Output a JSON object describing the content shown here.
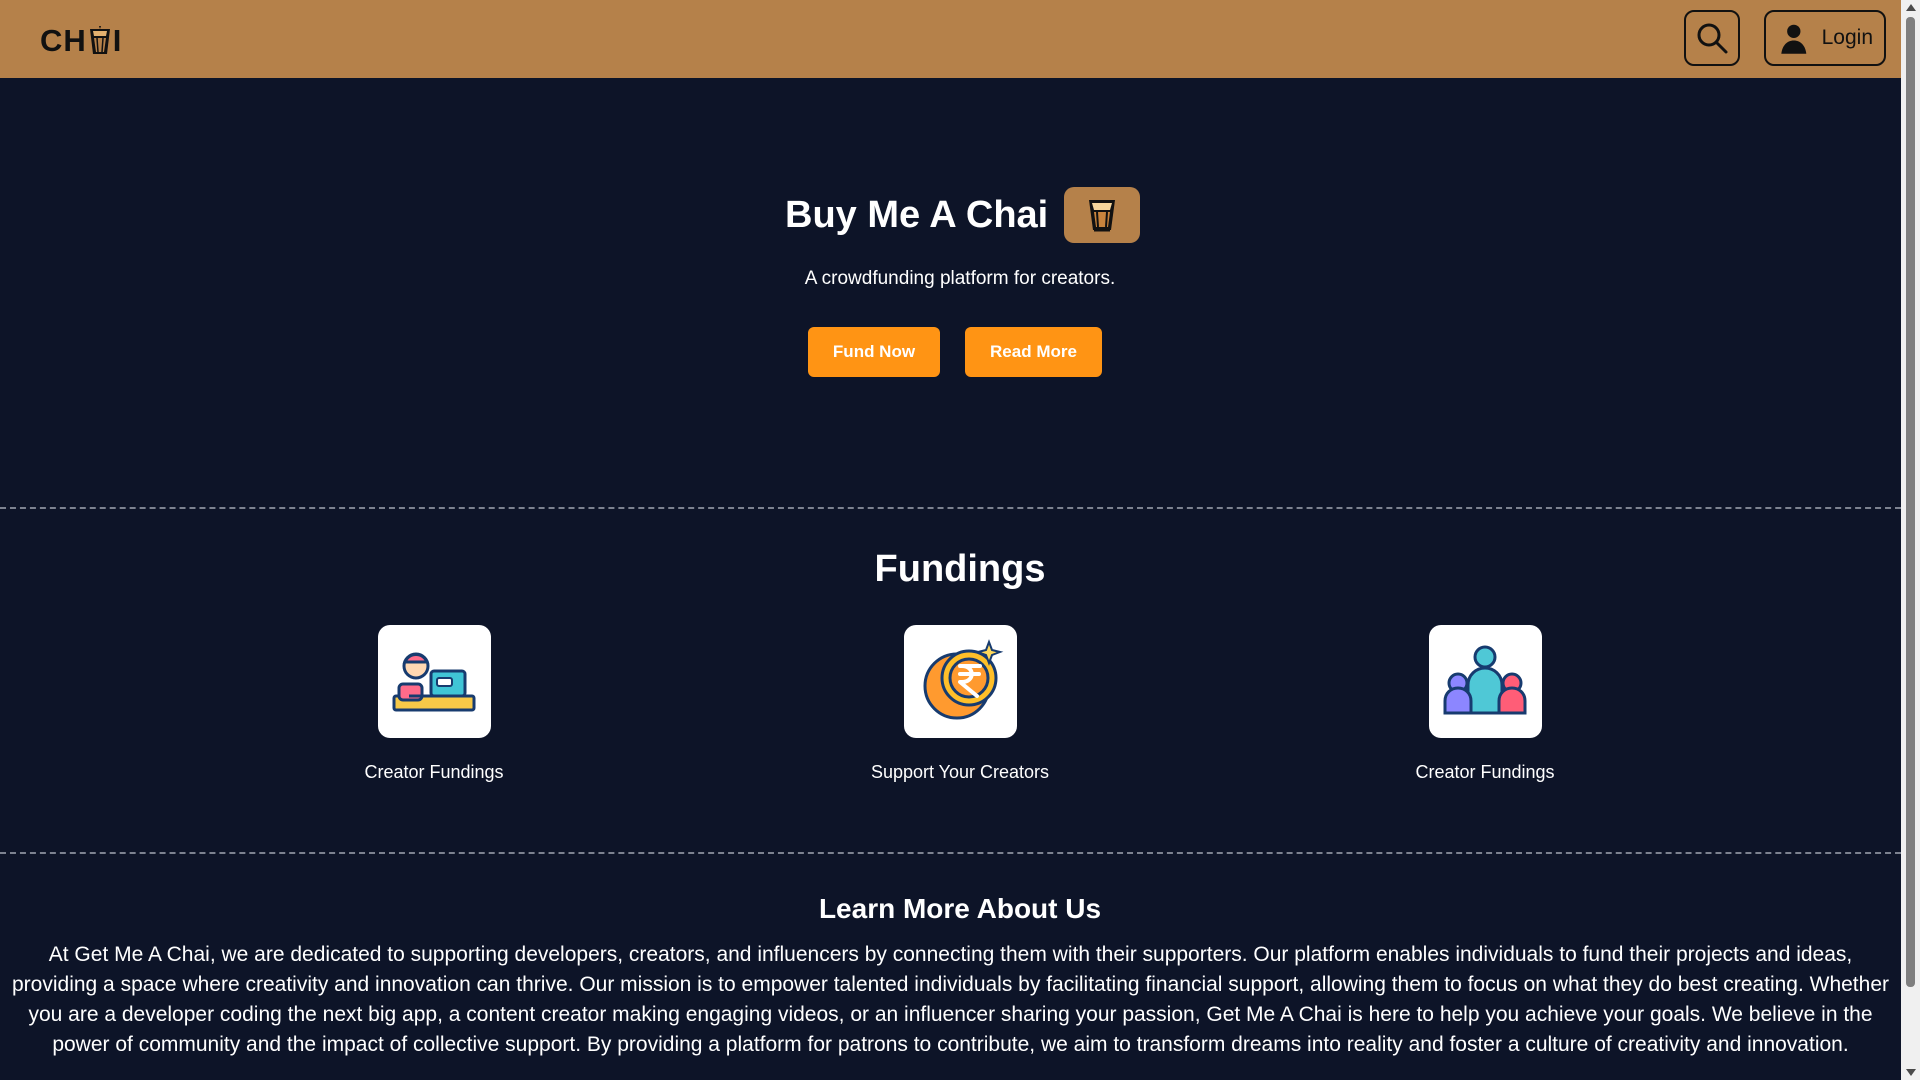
{
  "navbar": {
    "logo_text": "CH",
    "logo_text_end": "I",
    "search_icon": "search-icon",
    "login_label": "Login",
    "login_icon": "user-icon",
    "background_color": "#b5814a"
  },
  "hero": {
    "title": "Buy Me A Chai",
    "badge_icon": "chai-cup-icon",
    "subtitle": "A crowdfunding platform for creators.",
    "buttons": [
      {
        "label": "Fund Now"
      },
      {
        "label": "Read More"
      }
    ],
    "accent_color": "#ff9414"
  },
  "fundings": {
    "title": "Fundings",
    "items": [
      {
        "label": "Creator Fundings",
        "icon": "creator-laptop-icon"
      },
      {
        "label": "Support Your Creators",
        "icon": "rupee-coin-icon"
      },
      {
        "label": "Creator Fundings",
        "icon": "community-people-icon"
      }
    ]
  },
  "about": {
    "title": "Learn More About Us",
    "body": "At Get Me A Chai, we are dedicated to supporting developers, creators, and influencers by connecting them with their supporters. Our platform enables individuals to fund their projects and ideas, providing a space where creativity and innovation can thrive. Our mission is to empower talented individuals by facilitating financial support, allowing them to focus on what they do best creating. Whether you are a developer coding the next big app, a content creator making engaging videos, or an influencer sharing your passion, Get Me A Chai is here to help you achieve your goals. We believe in the power of community and the impact of collective support. By providing a platform for patrons to contribute, we aim to transform dreams into reality and foster a culture of creativity and innovation."
  },
  "theme": {
    "page_background": "#0d1428",
    "text_color": "#ffffff",
    "divider_color": "#7c8290"
  }
}
